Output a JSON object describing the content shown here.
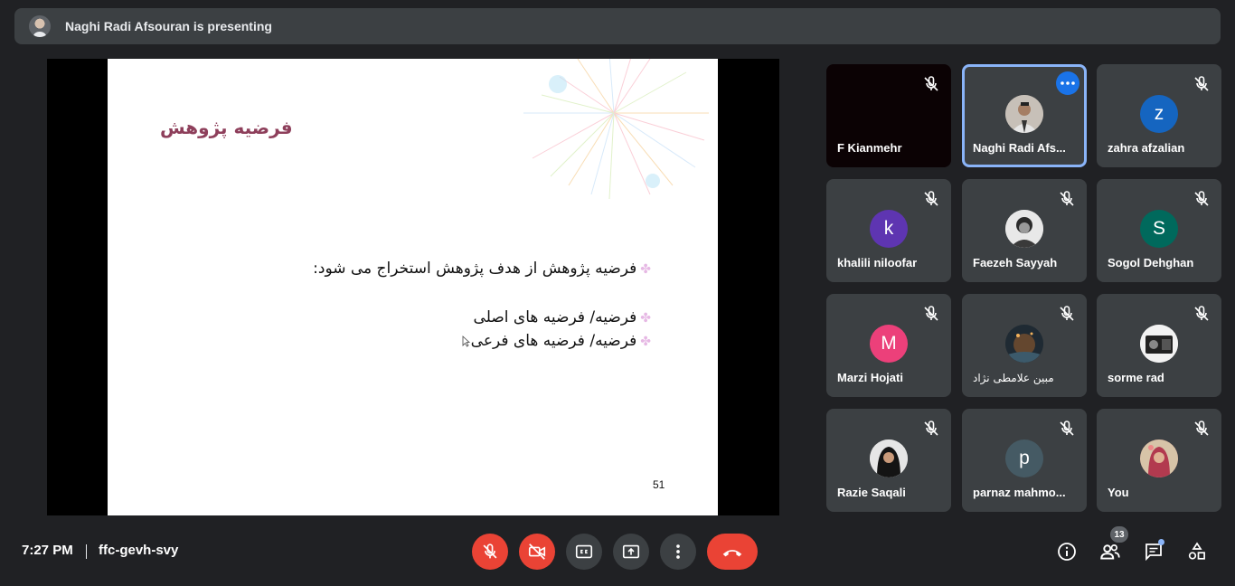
{
  "banner": {
    "text": "Naghi Radi Afsouran is presenting",
    "avatar_icon": "presenter-avatar"
  },
  "slide": {
    "title": "فرضیه پژوهش",
    "bullets": [
      "فرضیه پژوهش از هدف پژوهش استخراج می شود:",
      "فرضیه/ فرضیه های اصلی",
      "فرضیه/ فرضیه های فرعی"
    ],
    "page_number": "51",
    "title_color": "#8e3f5b"
  },
  "participants": [
    {
      "name": "F Kianmehr",
      "initial": "",
      "muted": true
    },
    {
      "name": "Naghi Radi Afs...",
      "initial": "",
      "muted": false,
      "active": true
    },
    {
      "name": "zahra afzalian",
      "initial": "z",
      "color": "#1565c0",
      "muted": true
    },
    {
      "name": "khalili niloofar",
      "initial": "k",
      "color": "#5e35b1",
      "muted": true
    },
    {
      "name": "Faezeh Sayyah",
      "initial": "",
      "muted": true
    },
    {
      "name": "Sogol Dehghan",
      "initial": "S",
      "color": "#00695c",
      "muted": true
    },
    {
      "name": "Marzi Hojati",
      "initial": "M",
      "color": "#ec407a",
      "muted": true
    },
    {
      "name": "مبین علامطی نژاد",
      "initial": "",
      "muted": true
    },
    {
      "name": "sorme rad",
      "initial": "",
      "muted": true
    },
    {
      "name": "Razie Saqali",
      "initial": "",
      "muted": true
    },
    {
      "name": "parnaz mahmo...",
      "initial": "p",
      "color": "#455a64",
      "muted": true
    },
    {
      "name": "You",
      "initial": "",
      "muted": true
    }
  ],
  "bottom": {
    "time": "7:27 PM",
    "meeting_code": "ffc-gevh-svy",
    "people_count": "13"
  },
  "colors": {
    "danger": "#ea4335",
    "accent": "#8ab4f8",
    "tile": "#3c4043",
    "background": "#202124"
  }
}
